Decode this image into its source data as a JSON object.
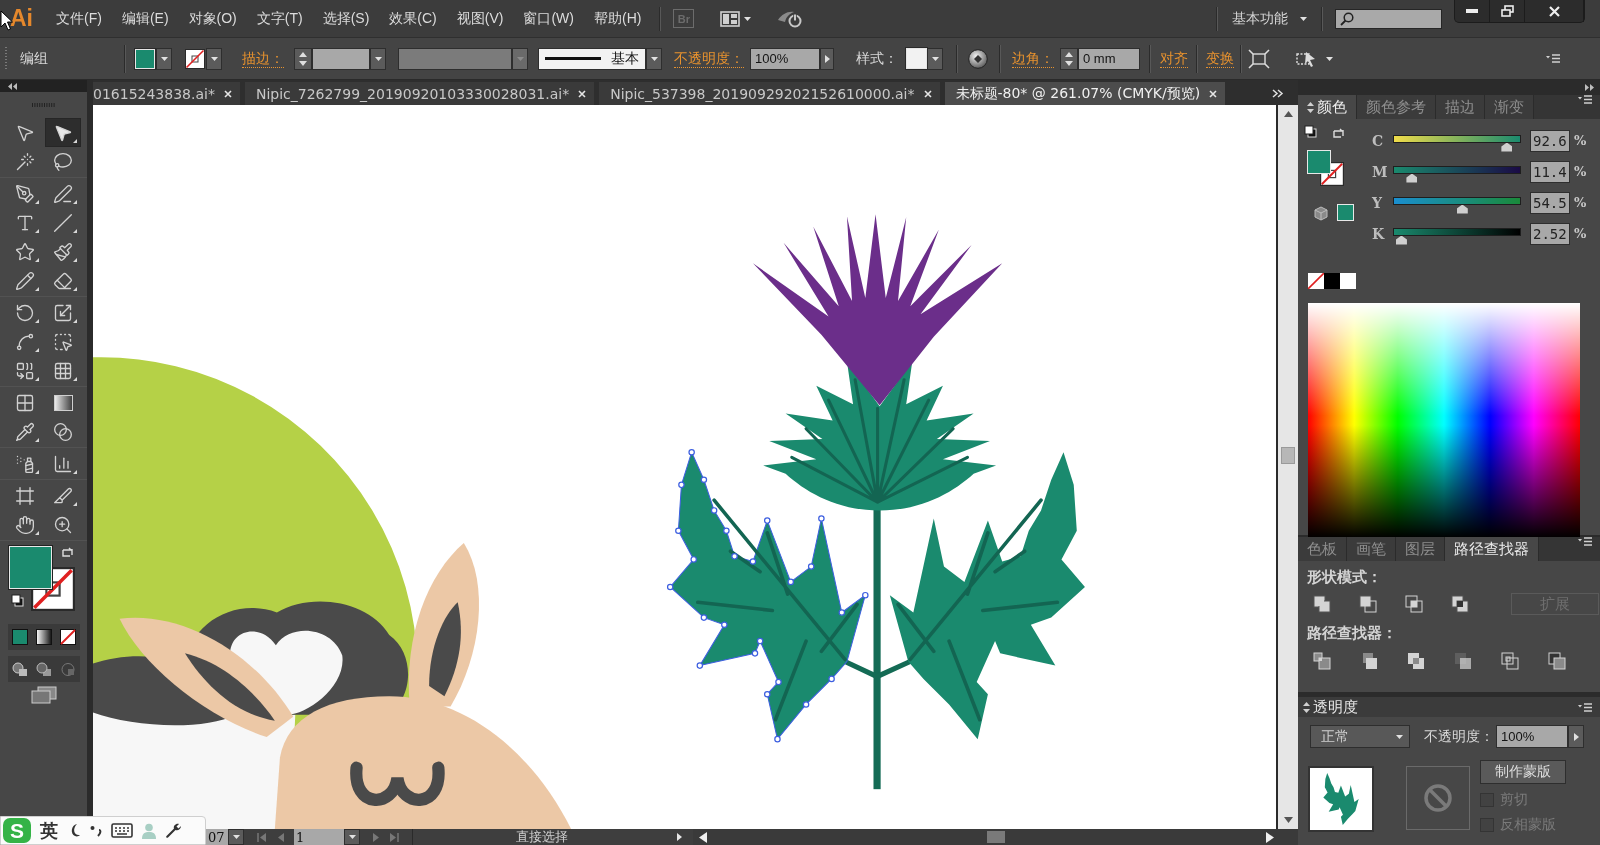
{
  "menu_bar": {
    "logo": "Ai",
    "menus": [
      "文件(F)",
      "编辑(E)",
      "对象(O)",
      "文字(T)",
      "选择(S)",
      "效果(C)",
      "视图(V)",
      "窗口(W)",
      "帮助(H)"
    ],
    "bridge": "Br",
    "workspace": "基本功能"
  },
  "control_bar": {
    "selection": "编组",
    "stroke_label": "描边：",
    "stroke_style": "基本",
    "opacity_label": "不透明度：",
    "opacity": "100%",
    "style_label": "样式：",
    "corner_label": "边角：",
    "corner_value": "0 mm",
    "align": "对齐",
    "transform": "变换"
  },
  "document_tabs": [
    {
      "label": "01615243838.ai*",
      "selected": false
    },
    {
      "label": "Nipic_7262799_20190920103330028031.ai*",
      "selected": false
    },
    {
      "label": "Nipic_537398_20190929202152610000.ai*",
      "selected": false
    },
    {
      "label": "未标题-80* @ 261.07% (CMYK/预览)",
      "selected": true
    }
  ],
  "toolbar": {
    "tools": [
      {
        "kind": "selection",
        "selected": false,
        "flyout": false
      },
      {
        "kind": "direct",
        "selected": true,
        "flyout": true
      },
      {
        "kind": "wand",
        "selected": false,
        "flyout": false
      },
      {
        "kind": "lasso",
        "selected": false,
        "flyout": false
      },
      {
        "kind": "pen",
        "selected": false,
        "flyout": true
      },
      {
        "kind": "curvature",
        "selected": false,
        "flyout": true
      },
      {
        "kind": "type",
        "selected": false,
        "flyout": true
      },
      {
        "kind": "line",
        "selected": false,
        "flyout": true
      },
      {
        "kind": "star",
        "selected": false,
        "flyout": true
      },
      {
        "kind": "brush",
        "selected": false,
        "flyout": true
      },
      {
        "kind": "pencil",
        "selected": false,
        "flyout": true
      },
      {
        "kind": "eraser",
        "selected": false,
        "flyout": true
      },
      {
        "kind": "rotate",
        "selected": false,
        "flyout": true
      },
      {
        "kind": "scale",
        "selected": false,
        "flyout": true
      },
      {
        "kind": "warp",
        "selected": false,
        "flyout": true
      },
      {
        "kind": "transform",
        "selected": false,
        "flyout": false
      },
      {
        "kind": "builder",
        "selected": false,
        "flyout": true
      },
      {
        "kind": "perspective",
        "selected": false,
        "flyout": true
      },
      {
        "kind": "mesh",
        "selected": false,
        "flyout": false
      },
      {
        "kind": "gradient",
        "selected": false,
        "flyout": false
      },
      {
        "kind": "eyedropper",
        "selected": false,
        "flyout": true
      },
      {
        "kind": "blend",
        "selected": false,
        "flyout": false
      },
      {
        "kind": "symbol",
        "selected": false,
        "flyout": true
      },
      {
        "kind": "graph",
        "selected": false,
        "flyout": true
      },
      {
        "kind": "artboard",
        "selected": false,
        "flyout": false
      },
      {
        "kind": "slice",
        "selected": false,
        "flyout": true
      },
      {
        "kind": "hand",
        "selected": false,
        "flyout": true
      },
      {
        "kind": "zoom",
        "selected": false,
        "flyout": false
      }
    ]
  },
  "color_panel": {
    "tabs": [
      {
        "label": "颜色",
        "selected": true
      },
      {
        "label": "颜色参考",
        "selected": false
      },
      {
        "label": "描边",
        "selected": false
      },
      {
        "label": "渐变",
        "selected": false
      }
    ],
    "channels": [
      {
        "label": "C",
        "value": "92.6",
        "unit": "%",
        "level": 0.9262
      },
      {
        "label": "M",
        "value": "11.4",
        "unit": "%",
        "level": 0.1146
      },
      {
        "label": "Y",
        "value": "54.5",
        "unit": "%",
        "level": 0.5453
      },
      {
        "label": "K",
        "value": "2.52",
        "unit": "%",
        "level": 0.0252
      }
    ]
  },
  "pathfinder_panel": {
    "tabs": [
      {
        "label": "色板",
        "selected": false
      },
      {
        "label": "画笔",
        "selected": false
      },
      {
        "label": "图层",
        "selected": false
      },
      {
        "label": "路径查找器",
        "selected": true
      }
    ],
    "shape_modes_label": "形状模式：",
    "expand_button": {
      "label": "扩展",
      "disabled": true
    },
    "pathfinders_label": "路径查找器："
  },
  "transparency_panel": {
    "title": "透明度",
    "blend_mode": "正常",
    "opacity_label": "不透明度：",
    "opacity": "100%",
    "make_mask_button": "制作蒙版",
    "checkboxes": [
      {
        "label": "剪切",
        "checked": false,
        "disabled": true
      },
      {
        "label": "反相蒙版",
        "checked": false,
        "disabled": true
      }
    ]
  },
  "status_bar": {
    "zoom": "07",
    "artboard": "1",
    "tool": "直接选择"
  },
  "ime_bar": {
    "logo": "S",
    "mode": "英"
  }
}
